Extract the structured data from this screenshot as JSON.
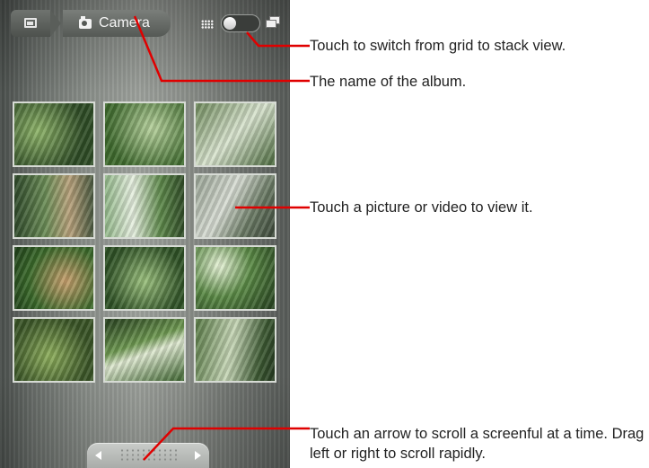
{
  "app": {
    "album_name": "Camera",
    "icons": {
      "home": "gallery-icon",
      "album": "camera-icon",
      "grid": "grid-view-icon",
      "stack": "stack-view-icon"
    },
    "view_toggle": {
      "selected": "grid"
    }
  },
  "thumbnails": [
    {
      "label": "photo-1"
    },
    {
      "label": "photo-2"
    },
    {
      "label": "photo-3"
    },
    {
      "label": "photo-4"
    },
    {
      "label": "photo-5"
    },
    {
      "label": "photo-6"
    },
    {
      "label": "photo-7"
    },
    {
      "label": "photo-8"
    },
    {
      "label": "photo-9"
    },
    {
      "label": "photo-10"
    },
    {
      "label": "photo-11"
    },
    {
      "label": "photo-12"
    }
  ],
  "callouts": {
    "switch_view": "Touch to switch from grid to stack view.",
    "album_name": "The name of the album.",
    "view_picture": "Touch a picture or video to view it.",
    "scroll": "Touch an arrow to scroll a screenful at a time. Drag left or right to scroll rapidly."
  },
  "colors": {
    "callout_line": "#e00000",
    "callout_text": "#222222"
  }
}
